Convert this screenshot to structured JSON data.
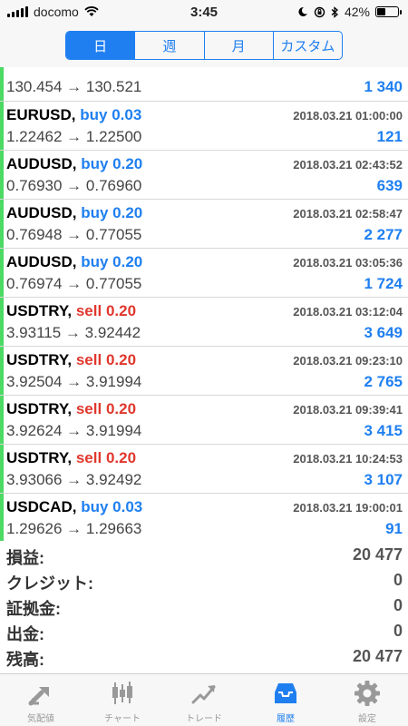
{
  "status": {
    "carrier": "docomo",
    "time": "3:45",
    "battery": "42%",
    "battery_level": 0.42
  },
  "segments": [
    "日",
    "週",
    "月",
    "カスタム"
  ],
  "active_segment": 0,
  "trades": [
    {
      "symbol": "",
      "side": "",
      "side_type": "buy",
      "lots": "",
      "date": "",
      "prices": "130.454 → 130.521",
      "profit": "1 340",
      "partial": true
    },
    {
      "symbol": "EURUSD,",
      "side": "buy",
      "side_type": "buy",
      "lots": "0.03",
      "date": "2018.03.21 01:00:00",
      "prices": "1.22462 → 1.22500",
      "profit": "121"
    },
    {
      "symbol": "AUDUSD,",
      "side": "buy",
      "side_type": "buy",
      "lots": "0.20",
      "date": "2018.03.21 02:43:52",
      "prices": "0.76930 → 0.76960",
      "profit": "639"
    },
    {
      "symbol": "AUDUSD,",
      "side": "buy",
      "side_type": "buy",
      "lots": "0.20",
      "date": "2018.03.21 02:58:47",
      "prices": "0.76948 → 0.77055",
      "profit": "2 277"
    },
    {
      "symbol": "AUDUSD,",
      "side": "buy",
      "side_type": "buy",
      "lots": "0.20",
      "date": "2018.03.21 03:05:36",
      "prices": "0.76974 → 0.77055",
      "profit": "1 724"
    },
    {
      "symbol": "USDTRY,",
      "side": "sell",
      "side_type": "sell",
      "lots": "0.20",
      "date": "2018.03.21 03:12:04",
      "prices": "3.93115 → 3.92442",
      "profit": "3 649"
    },
    {
      "symbol": "USDTRY,",
      "side": "sell",
      "side_type": "sell",
      "lots": "0.20",
      "date": "2018.03.21 09:23:10",
      "prices": "3.92504 → 3.91994",
      "profit": "2 765"
    },
    {
      "symbol": "USDTRY,",
      "side": "sell",
      "side_type": "sell",
      "lots": "0.20",
      "date": "2018.03.21 09:39:41",
      "prices": "3.92624 → 3.91994",
      "profit": "3 415"
    },
    {
      "symbol": "USDTRY,",
      "side": "sell",
      "side_type": "sell",
      "lots": "0.20",
      "date": "2018.03.21 10:24:53",
      "prices": "3.93066 → 3.92492",
      "profit": "3 107"
    },
    {
      "symbol": "USDCAD,",
      "side": "buy",
      "side_type": "buy",
      "lots": "0.03",
      "date": "2018.03.21 19:00:01",
      "prices": "1.29626 → 1.29663",
      "profit": "91"
    }
  ],
  "summary": [
    {
      "label": "損益:",
      "value": "20 477"
    },
    {
      "label": "クレジット:",
      "value": "0"
    },
    {
      "label": "証拠金:",
      "value": "0"
    },
    {
      "label": "出金:",
      "value": "0"
    },
    {
      "label": "残高:",
      "value": "20 477"
    }
  ],
  "tabs": [
    {
      "label": "気配値",
      "icon": "quotes-icon"
    },
    {
      "label": "チャート",
      "icon": "chart-icon"
    },
    {
      "label": "トレード",
      "icon": "trade-icon"
    },
    {
      "label": "履歴",
      "icon": "history-icon"
    },
    {
      "label": "設定",
      "icon": "settings-icon"
    }
  ],
  "active_tab": 3,
  "colors": {
    "accent": "#1f7ff0",
    "sell": "#e0382e",
    "indicator": "#4cd964"
  }
}
